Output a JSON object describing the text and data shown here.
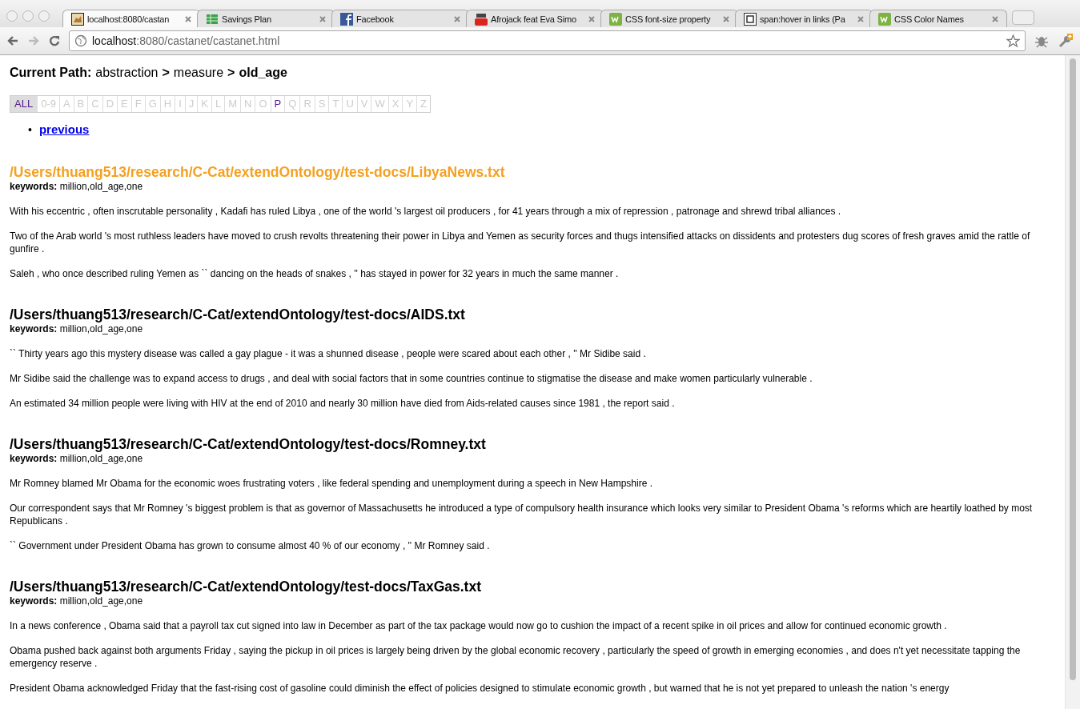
{
  "browser": {
    "tabs": [
      {
        "title": "localhost:8080/castan",
        "selected": true
      },
      {
        "title": "Savings Plan",
        "selected": false
      },
      {
        "title": "Facebook",
        "selected": false
      },
      {
        "title": "Afrojack feat Eva Simo",
        "selected": false
      },
      {
        "title": "CSS font-size property",
        "selected": false
      },
      {
        "title": "span:hover in links (Pa",
        "selected": false
      },
      {
        "title": "CSS Color Names",
        "selected": false
      }
    ],
    "address": {
      "host": "localhost",
      "rest": ":8080/castanet/castanet.html"
    }
  },
  "path": {
    "label": "Current Path:",
    "parts": [
      {
        "text": "abstraction",
        "current": false
      },
      {
        "text": "measure",
        "current": false
      },
      {
        "text": "old_age",
        "current": true
      }
    ],
    "separator": ">"
  },
  "letters": [
    {
      "label": "ALL",
      "selected": true,
      "disabled": false
    },
    {
      "label": "0-9",
      "selected": false,
      "disabled": true
    },
    {
      "label": "A",
      "selected": false,
      "disabled": true
    },
    {
      "label": "B",
      "selected": false,
      "disabled": true
    },
    {
      "label": "C",
      "selected": false,
      "disabled": true
    },
    {
      "label": "D",
      "selected": false,
      "disabled": true
    },
    {
      "label": "E",
      "selected": false,
      "disabled": true
    },
    {
      "label": "F",
      "selected": false,
      "disabled": true
    },
    {
      "label": "G",
      "selected": false,
      "disabled": true
    },
    {
      "label": "H",
      "selected": false,
      "disabled": true
    },
    {
      "label": "I",
      "selected": false,
      "disabled": true
    },
    {
      "label": "J",
      "selected": false,
      "disabled": true
    },
    {
      "label": "K",
      "selected": false,
      "disabled": true
    },
    {
      "label": "L",
      "selected": false,
      "disabled": true
    },
    {
      "label": "M",
      "selected": false,
      "disabled": true
    },
    {
      "label": "N",
      "selected": false,
      "disabled": true
    },
    {
      "label": "O",
      "selected": false,
      "disabled": true
    },
    {
      "label": "P",
      "selected": false,
      "disabled": false
    },
    {
      "label": "Q",
      "selected": false,
      "disabled": true
    },
    {
      "label": "R",
      "selected": false,
      "disabled": true
    },
    {
      "label": "S",
      "selected": false,
      "disabled": true
    },
    {
      "label": "T",
      "selected": false,
      "disabled": true
    },
    {
      "label": "U",
      "selected": false,
      "disabled": true
    },
    {
      "label": "V",
      "selected": false,
      "disabled": true
    },
    {
      "label": "W",
      "selected": false,
      "disabled": true
    },
    {
      "label": "X",
      "selected": false,
      "disabled": true
    },
    {
      "label": "Y",
      "selected": false,
      "disabled": true
    },
    {
      "label": "Z",
      "selected": false,
      "disabled": true
    }
  ],
  "nav_links": [
    {
      "bullet": "•",
      "label": "previous"
    }
  ],
  "documents": [
    {
      "path": "/Users/thuang513/research/C-Cat/extendOntology/test-docs/LibyaNews.txt",
      "highlighted": true,
      "keywords_label": "keywords:",
      "keywords": "million,old_age,one",
      "paragraphs": [
        "With his eccentric , often inscrutable personality , Kadafi has ruled Libya , one of the world 's largest oil producers , for 41 years through a mix of repression , patronage and shrewd tribal alliances .",
        "Two of the Arab world 's most ruthless leaders have moved to crush revolts threatening their power in Libya and Yemen as security forces and thugs intensified attacks on dissidents and protesters dug scores of fresh graves amid the rattle of gunfire .",
        "Saleh , who once described ruling Yemen as `` dancing on the heads of snakes , '' has stayed in power for 32 years in much the same manner ."
      ]
    },
    {
      "path": "/Users/thuang513/research/C-Cat/extendOntology/test-docs/AIDS.txt",
      "highlighted": false,
      "keywords_label": "keywords:",
      "keywords": "million,old_age,one",
      "paragraphs": [
        "`` Thirty years ago this mystery disease was called a gay plague - it was a shunned disease , people were scared about each other , '' Mr Sidibe said .",
        "Mr Sidibe said the challenge was to expand access to drugs , and deal with social factors that in some countries continue to stigmatise the disease and make women particularly vulnerable .",
        "An estimated 34 million people were living with HIV at the end of 2010 and nearly 30 million have died from Aids-related causes since 1981 , the report said ."
      ]
    },
    {
      "path": "/Users/thuang513/research/C-Cat/extendOntology/test-docs/Romney.txt",
      "highlighted": false,
      "keywords_label": "keywords:",
      "keywords": "million,old_age,one",
      "paragraphs": [
        "Mr Romney blamed Mr Obama for the economic woes frustrating voters , like federal spending and unemployment during a speech in New Hampshire .",
        "Our correspondent says that Mr Romney 's biggest problem is that as governor of Massachusetts he introduced a type of compulsory health insurance which looks very similar to President Obama 's reforms which are heartily loathed by most Republicans .",
        "`` Government under President Obama has grown to consume almost 40 % of our economy , '' Mr Romney said ."
      ]
    },
    {
      "path": "/Users/thuang513/research/C-Cat/extendOntology/test-docs/TaxGas.txt",
      "highlighted": false,
      "keywords_label": "keywords:",
      "keywords": "million,old_age,one",
      "paragraphs": [
        "In a news conference , Obama said that a payroll tax cut signed into law in December as part of the tax package would now go to cushion the impact of a recent spike in oil prices and allow for continued economic growth .",
        "Obama pushed back against both arguments Friday , saying the pickup in oil prices is largely being driven by the global economic recovery , particularly the speed of growth in emerging economies , and does n't yet necessitate tapping the emergency reserve .",
        "President Obama acknowledged Friday that the fast-rising cost of gasoline could diminish the effect of policies designed to stimulate economic growth , but warned that he is not yet prepared to unleash the nation 's energy"
      ]
    }
  ]
}
